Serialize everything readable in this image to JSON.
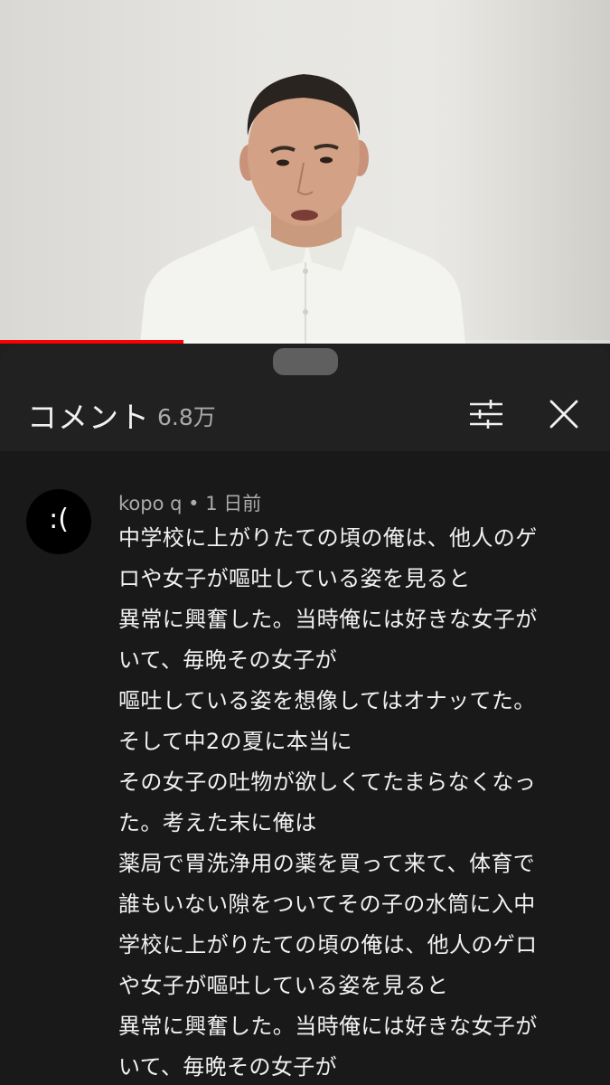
{
  "video": {
    "progress_fraction": 0.3,
    "colors": {
      "progress": "#ff0000",
      "wall": "#e6e5e1",
      "shirt": "#f4f4f0"
    }
  },
  "comments_panel": {
    "title": "コメント",
    "count": "6.8万",
    "filter_icon": "filter-sliders-icon",
    "close_icon": "close-icon"
  },
  "comment": {
    "avatar_text": ":(",
    "author": "kopo q",
    "separator": "•",
    "time": "1 日前",
    "lines": [
      "中学校に上がりたての頃の俺は、他人のゲ",
      "ロや女子が嘔吐している姿を見ると",
      "異常に興奮した。当時俺には好きな女子が",
      "いて、毎晩その女子が",
      "嘔吐している姿を想像してはオナッてた。",
      "そして中2の夏に本当に",
      "その女子の吐物が欲しくてたまらなくなっ",
      "た。考えた末に俺は",
      "薬局で胃洗浄用の薬を買って来て、体育で",
      "誰もいない隙をついてその子の水筒に入中",
      "学校に上がりたての頃の俺は、他人のゲロ",
      "や女子が嘔吐している姿を見ると",
      "異常に興奮した。当時俺には好きな女子が",
      "いて、毎晩その女子が"
    ]
  },
  "colors": {
    "sheet_bg": "#212121",
    "comment_bg": "#191919",
    "text_primary": "#f1f1f1",
    "text_secondary": "#aaaaaa"
  }
}
